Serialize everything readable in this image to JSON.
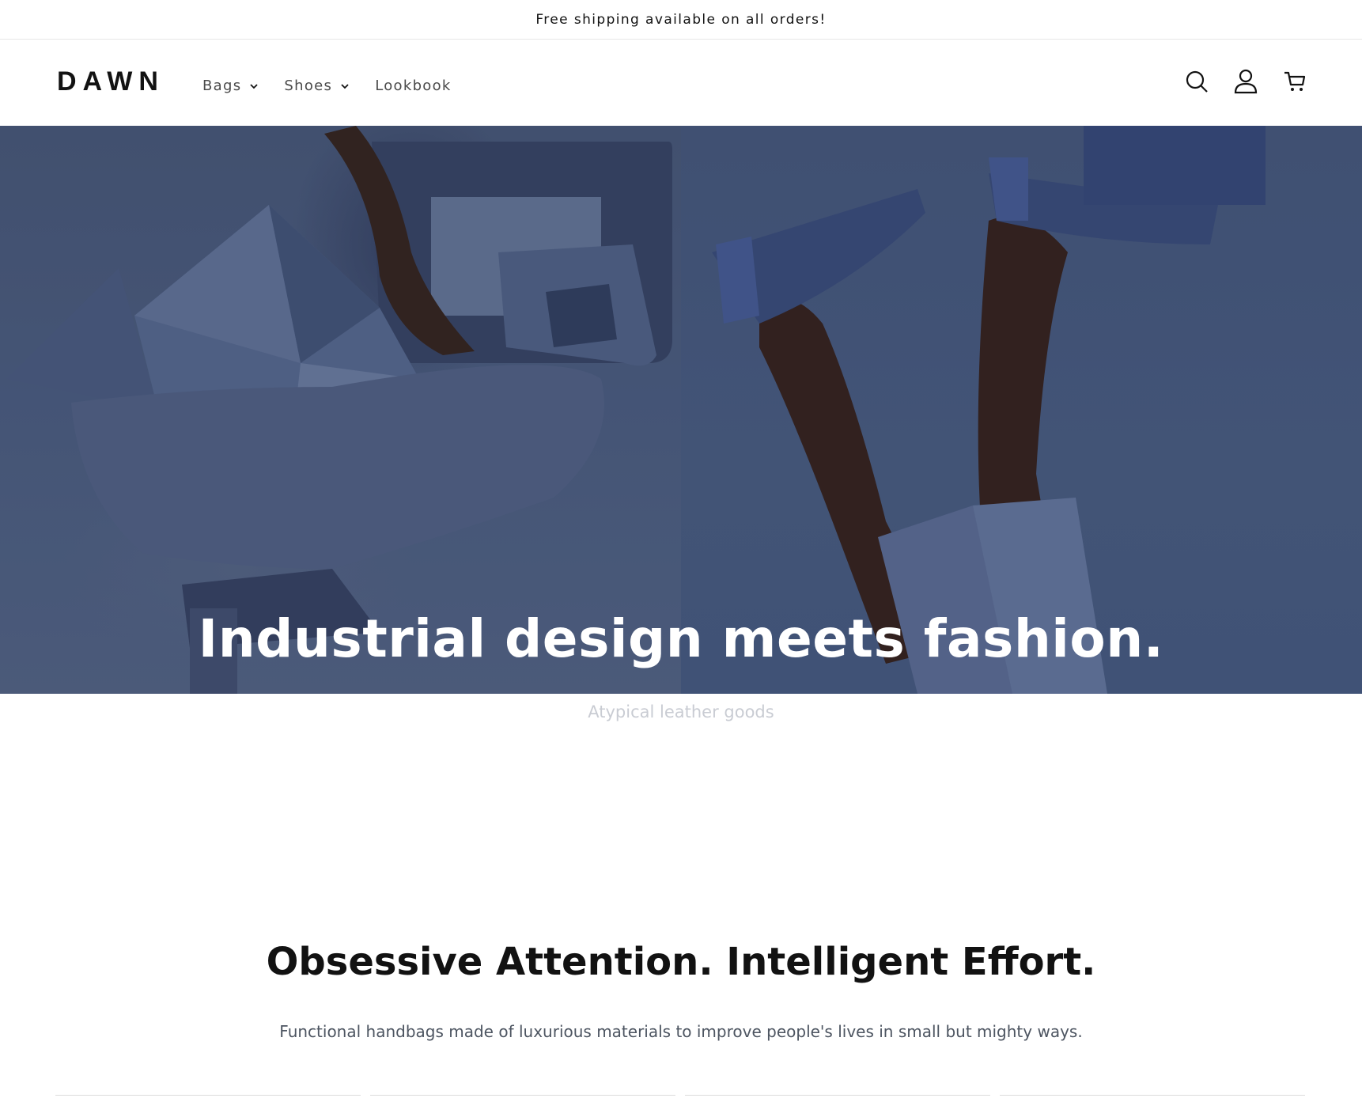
{
  "announcement": {
    "text": "Free shipping available on all orders!"
  },
  "header": {
    "logo": "DAWN",
    "nav": [
      {
        "label": "Bags",
        "has_dropdown": true
      },
      {
        "label": "Shoes",
        "has_dropdown": true
      },
      {
        "label": "Lookbook",
        "has_dropdown": false
      }
    ],
    "icons": [
      "search-icon",
      "account-icon",
      "cart-icon"
    ]
  },
  "hero": {
    "title": "Industrial design meets fashion.",
    "subtitle": "Atypical leather goods",
    "colors": {
      "left_bg": "#54668a",
      "right_bg": "#50648a"
    }
  },
  "section": {
    "title": "Obsessive Attention. Intelligent Effort.",
    "text": "Functional handbags made of luxurious materials to improve people's lives in small but mighty ways."
  }
}
